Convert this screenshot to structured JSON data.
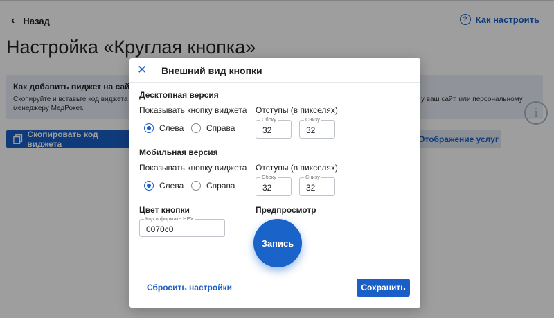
{
  "page": {
    "back_label": "Назад",
    "howto_label": "Как настроить",
    "title": "Настройка «Круглая кнопка»",
    "info": {
      "title": "Как добавить виджет на сайт",
      "text_line1": "Скопируйте и вставьте код виджета в",
      "text_line2": "менеджеру МедРокет.",
      "text_right": "у ваш сайт, или персональному"
    },
    "copy_button": "Скопировать код виджета",
    "services_button": "Отображение услуг"
  },
  "modal": {
    "title": "Внешний вид кнопки",
    "desktop": {
      "section_title": "Десктопная версия",
      "show_label": "Показывать кнопку виджета",
      "offsets_label": "Отступы (в пикселях)",
      "left_option": "Слева",
      "right_option": "Справа",
      "selected": "left",
      "side_label": "Сбоку",
      "side_value": "32",
      "bottom_label": "Снизу",
      "bottom_value": "32"
    },
    "mobile": {
      "section_title": "Мобильная версия",
      "show_label": "Показывать кнопку виджета",
      "offsets_label": "Отступы (в пикселях)",
      "left_option": "Слева",
      "right_option": "Справа",
      "selected": "left",
      "side_label": "Сбоку",
      "side_value": "32",
      "bottom_label": "Снизу",
      "bottom_value": "32"
    },
    "color": {
      "section_title": "Цвет кнопки",
      "field_label": "Код в формате HEX",
      "value": "0070c0"
    },
    "preview": {
      "section_title": "Предпросмотр",
      "button_label": "Запись"
    },
    "reset_label": "Сбросить настройки",
    "save_label": "Сохранить"
  },
  "colors": {
    "accent": "#1a5fc7",
    "preview_button": "#0070c0"
  }
}
